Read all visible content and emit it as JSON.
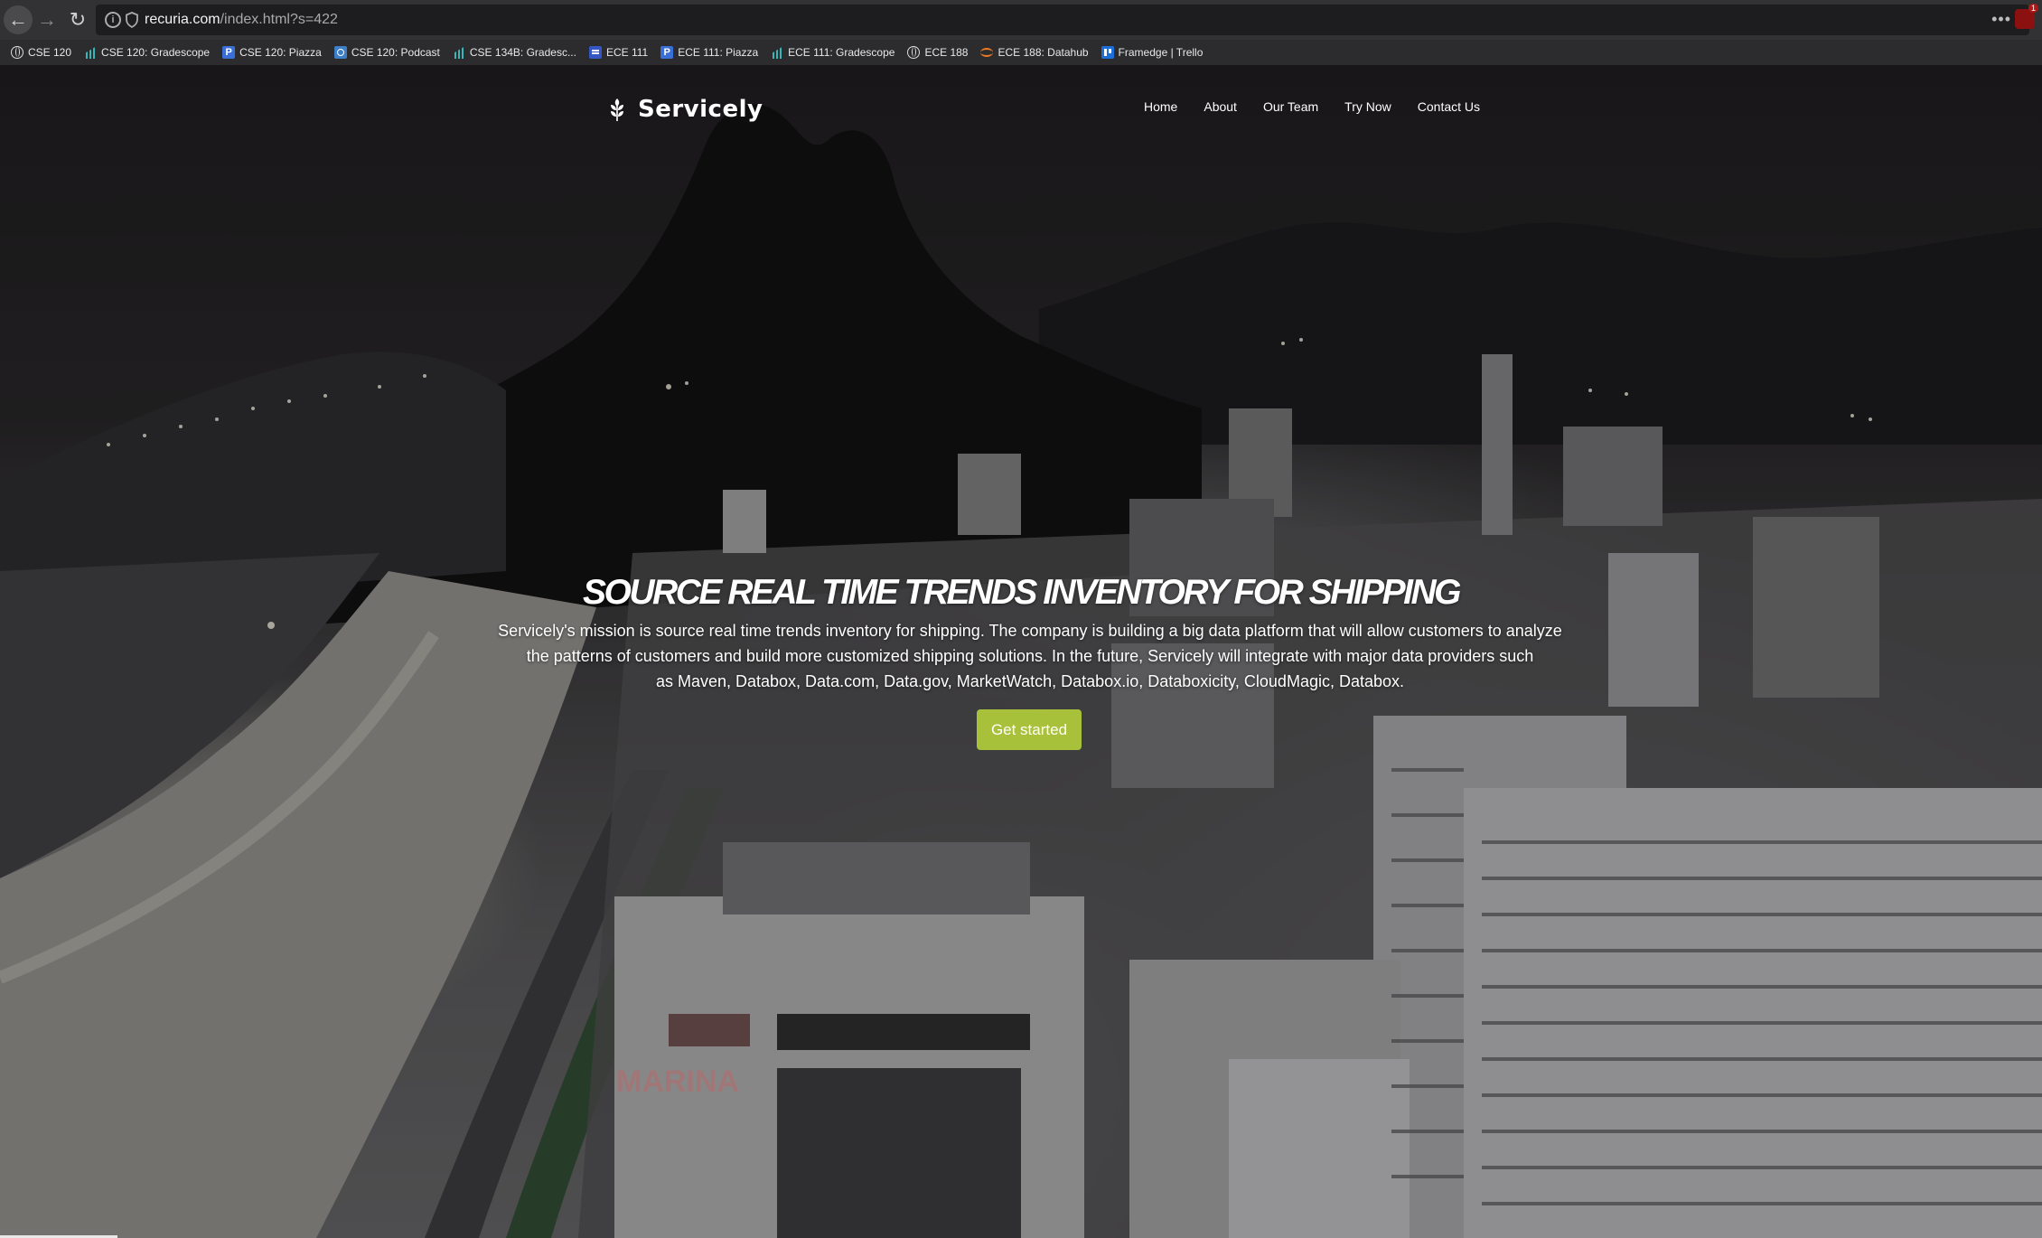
{
  "browser": {
    "url_host": "recuria.com",
    "url_path": "/index.html?s=422",
    "more_icon": "•••",
    "extension_badge": "1",
    "bookmarks": [
      {
        "label": "CSE 120",
        "icon": "globe"
      },
      {
        "label": "CSE 120: Gradescope",
        "icon": "bars"
      },
      {
        "label": "CSE 120: Piazza",
        "icon": "piazza"
      },
      {
        "label": "CSE 120: Podcast",
        "icon": "podcast"
      },
      {
        "label": "CSE 134B: Gradesc...",
        "icon": "bars"
      },
      {
        "label": "ECE 111",
        "icon": "ece"
      },
      {
        "label": "ECE 111: Piazza",
        "icon": "piazza"
      },
      {
        "label": "ECE 111: Gradescope",
        "icon": "bars"
      },
      {
        "label": "ECE 188",
        "icon": "globe"
      },
      {
        "label": "ECE 188: Datahub",
        "icon": "jupyter"
      },
      {
        "label": "Framedge | Trello",
        "icon": "trello"
      }
    ]
  },
  "site": {
    "brand": "Servicely",
    "nav": [
      "Home",
      "About",
      "Our Team",
      "Try Now",
      "Contact Us"
    ],
    "headline": "SOURCE REAL TIME TRENDS INVENTORY FOR SHIPPING",
    "mission_lines": [
      "Servicely's mission is source real time trends inventory for shipping. The company is building a big data platform that will allow customers to analyze",
      "the patterns of customers and build more customized shipping solutions. In the future, Servicely will integrate with major data providers such",
      "as Maven, Databox, Data.com, Data.gov, MarketWatch, Databox.io, Databoxicity, CloudMagic, Databox."
    ],
    "cta_label": "Get started",
    "hero_image_text": "MARINA"
  },
  "colors": {
    "cta": "#a7c23a",
    "toolbar": "#323234",
    "bookmarks_bar": "#2c2c2e"
  }
}
